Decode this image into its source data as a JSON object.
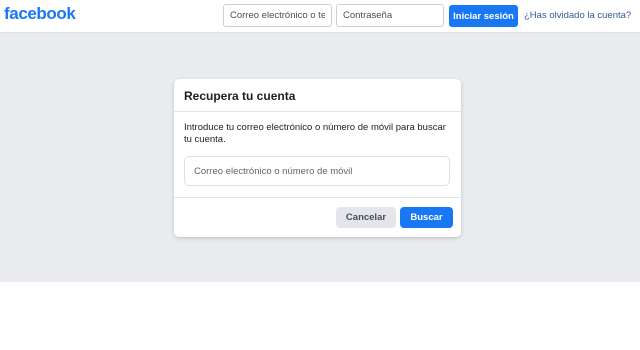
{
  "header": {
    "logo_text": "facebook",
    "email_placeholder": "Correo electrónico o teléfono",
    "password_placeholder": "Contraseña",
    "login_button": "Iniciar sesión",
    "forgot_link": "¿Has olvidado la cuenta?"
  },
  "recover": {
    "title": "Recupera tu cuenta",
    "description": "Introduce tu correo electrónico o número de móvil para buscar tu cuenta.",
    "input_placeholder": "Correo electrónico o número de móvil",
    "cancel_button": "Cancelar",
    "search_button": "Buscar"
  },
  "colors": {
    "brand": "#1877f2",
    "link": "#385898",
    "page_background": "#e9ebee"
  }
}
